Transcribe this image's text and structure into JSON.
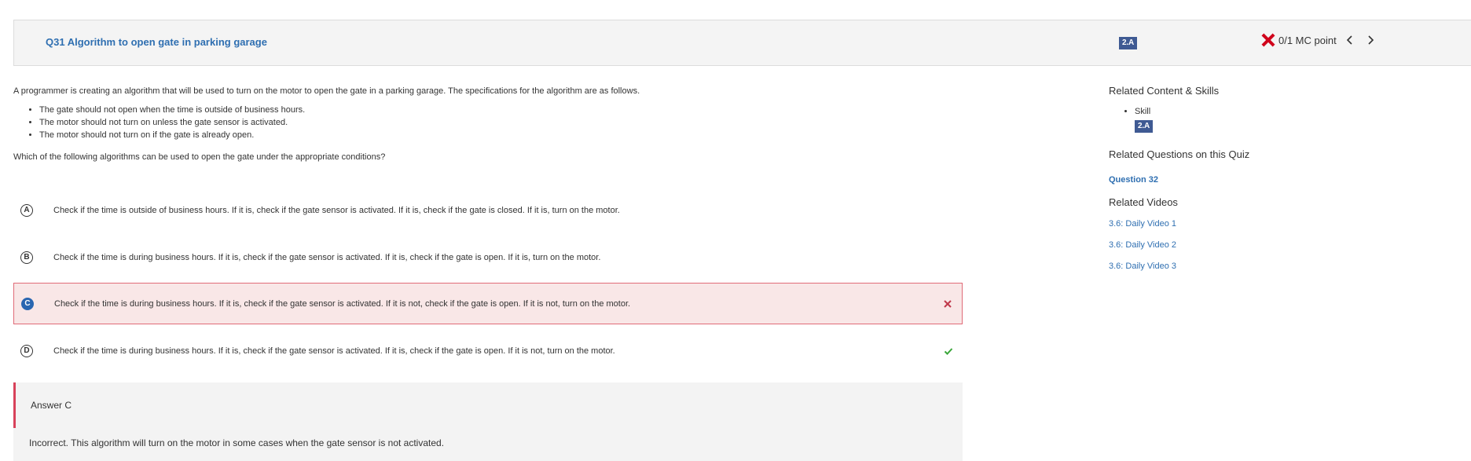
{
  "header": {
    "question_title": "Q31 Algorithm to open gate in parking garage",
    "skill_badge": "2.A",
    "score": "0/1 MC point"
  },
  "question": {
    "stem": "A programmer is creating an algorithm that will be used to turn on the motor to open the gate in a parking garage. The specifications for the algorithm are as follows.",
    "specs": [
      "The gate should not open when the time is outside of business hours.",
      "The motor should not turn on unless the gate sensor is activated.",
      "The motor should not turn on if the gate is already open."
    ],
    "prompt": "Which of the following algorithms can be used to open the gate under the appropriate conditions?"
  },
  "choices": [
    {
      "letter": "A",
      "text": "Check if the time is outside of business hours. If it is, check if the gate sensor is activated. If it is, check if the gate is closed. If it is, turn on the motor."
    },
    {
      "letter": "B",
      "text": "Check if the time is during business hours. If it is, check if the gate sensor is activated. If it is, check if the gate is open. If it is, turn on the motor."
    },
    {
      "letter": "C",
      "text": "Check if the time is during business hours. If it is, check if the gate sensor is activated. If it is not, check if the gate is open. If it is not, turn on the motor.",
      "state": "selected-wrong"
    },
    {
      "letter": "D",
      "text": "Check if the time is during business hours. If it is, check if the gate sensor is activated. If it is, check if the gate is open. If it is not, turn on the motor.",
      "state": "correct"
    }
  ],
  "answer": {
    "label": "Answer C",
    "explanation": "Incorrect. This algorithm will turn on the motor in some cases when the gate sensor is not activated."
  },
  "sidebar": {
    "related_content_heading": "Related Content & Skills",
    "skill_label": "Skill",
    "skill_badge": "2.A",
    "related_questions_heading": "Related Questions on this Quiz",
    "related_question_link": "Question 32",
    "related_videos_heading": "Related Videos",
    "videos": [
      "3.6: Daily Video 1",
      "3.6: Daily Video 2",
      "3.6: Daily Video 3"
    ]
  },
  "colors": {
    "link": "#2f6fb1",
    "badge": "#3f5a93",
    "wrong": "#d0021b",
    "correct": "#3aa63a",
    "wrong_bg": "#f9e7e7"
  },
  "icons": {
    "score_status": "x-icon",
    "prev": "chevron-left-icon",
    "next": "chevron-right-icon",
    "choice_wrong": "close-icon",
    "choice_correct": "check-icon"
  }
}
